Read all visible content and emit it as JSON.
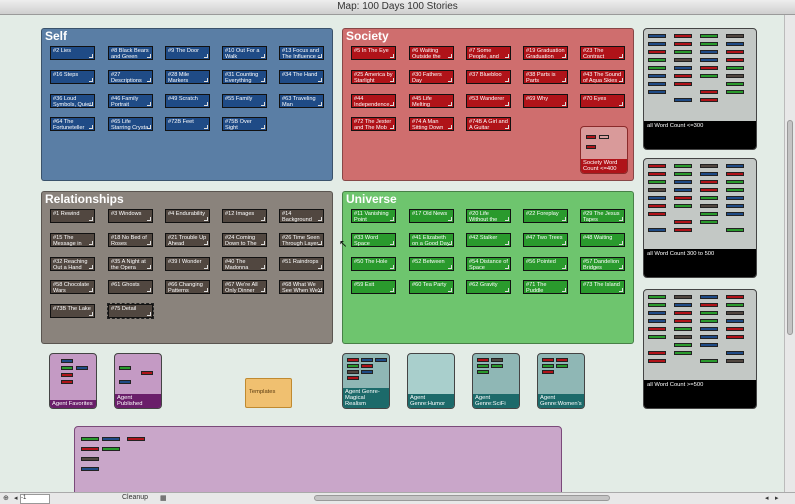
{
  "window": {
    "title": "Map: 100 Days 100 Stories"
  },
  "colors": {
    "blue_note": "#1f4b86",
    "red_note": "#b01319",
    "gray_note": "#514740",
    "green_note": "#2a9a2d"
  },
  "adornments": {
    "self": {
      "title": "Self"
    },
    "society": {
      "title": "Society"
    },
    "relationships": {
      "title": "Relationships"
    },
    "universe": {
      "title": "Universe"
    }
  },
  "self_notes": [
    "#2 Lies",
    "#8 Black Bears and Green",
    "#9 The Door",
    "#10 Out For a Walk",
    "#13 Focus and The Influence c",
    "#16 Steps",
    "#27 Descriptions",
    "#28 Mile Markers",
    "#31 Counting Everything",
    "#34 The Hand",
    "#36 Loud Symbols, Quiet",
    "#46 Family Portrait",
    "#49 Scratch",
    "#55 Family",
    "#63 Traveling Man",
    "#64 The Fortuneteller",
    "#65 Life Starring Crysta",
    "#72B Feet",
    "#75B Over Sight"
  ],
  "society_notes": [
    "#5 In The Eye",
    "#6 Waiting Outside the",
    "#7 Some People, and",
    "#19 Graduation Graduation",
    "#23 The Contract",
    "#25 America by Starlight",
    "#30 Fathers Day",
    "#37 Bluebloo",
    "#38 Parts is Parts",
    "#43 The Sound of Aqua Skies",
    "#44 Independence",
    "#45 Life Melting",
    "#53 Wanderer",
    "#69 Why",
    "#70 Eyes",
    "#72 The Jester and The Mob",
    "#74 A Man Sitting Down",
    "#74B A Girl and A Guitar"
  ],
  "society_agent": {
    "label": "Society Word Count <=400"
  },
  "relationship_notes": [
    "#1 Rewind",
    "#3 Windows",
    "#4 Endurability",
    "#12 Images",
    "#14 Background",
    "#15 The Message in",
    "#18 No Bed of Roses",
    "#21 Trouble Up Ahead",
    "#24 Coming Down to The",
    "#26 Time Seen Through Layer",
    "#32 Reaching Out a Hand",
    "#35 A Night at the Opera",
    "#39 I Wonder",
    "#40 The Madonna",
    "#51 Raindrops",
    "#58 Chocolate Wars",
    "#61 Ghosts",
    "#66 Changing Patterns",
    "#67 We're All Only Dinner",
    "#68 What We See When We'r",
    "#73B The Lake",
    "#75 Detail"
  ],
  "universe_notes": [
    "#11 Vanishing Point",
    "#17 Old News",
    "#20 Life Without the",
    "#22 Foreplay",
    "#29 The Jesus Tapes",
    "#33 Word Space",
    "#41 Elizabeth on a Good Day",
    "#42 Stalker",
    "#47 Two Trees",
    "#48 Waiting",
    "#50 The Hole",
    "#52 Between",
    "#54 Distance of Space",
    "#56 Pointed",
    "#57 Dandelion Bridges",
    "#59 Exit",
    "#60 Tea Party",
    "#62 Gravity",
    "#71 The Puddle",
    "#73 The Island"
  ],
  "word_count_agents": [
    {
      "label": "all Word Count <=300"
    },
    {
      "label": "all Word Count 300 to 500"
    },
    {
      "label": "all Word Count >=500"
    }
  ],
  "agents": {
    "favorites": "Agent Favorites",
    "published": "Agent Published",
    "templates": "Templates",
    "magical": "Agent Genre-Magical Realism",
    "humor": "Agent Genre:Humor",
    "scifi": "Agent Genre:SciFi",
    "womens": "Agent Genre:Women's"
  },
  "bottom": {
    "zoom": "-1",
    "cleanup": "Cleanup"
  }
}
